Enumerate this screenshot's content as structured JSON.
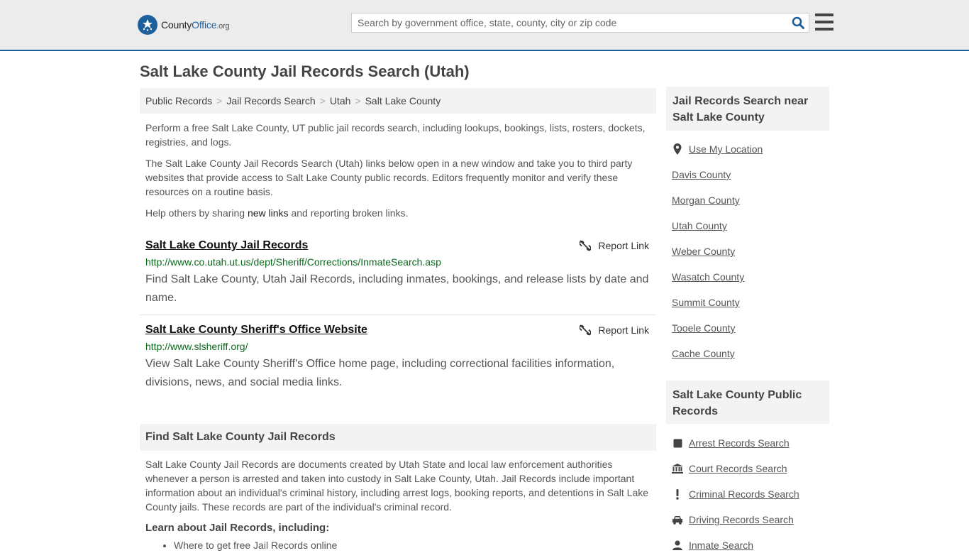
{
  "header": {
    "logo": {
      "word1": "County",
      "word2": "Office",
      "tld": ".org"
    },
    "search": {
      "placeholder": "Search by government office, state, county, city or zip code",
      "value": ""
    }
  },
  "page_title": "Salt Lake County Jail Records Search (Utah)",
  "breadcrumb": [
    "Public Records",
    "Jail Records Search",
    "Utah",
    "Salt Lake County"
  ],
  "breadcrumb_separator": ">",
  "intro": {
    "p1": "Perform a free Salt Lake County, UT public jail records search, including lookups, bookings, lists, rosters, dockets, registries, and logs.",
    "p2": "The Salt Lake County Jail Records Search (Utah) links below open in a new window and take you to third party websites that provide access to Salt Lake County public records. Editors frequently monitor and verify these resources on a routine basis.",
    "p3_before": "Help others by sharing ",
    "p3_link": "new links",
    "p3_after": " and reporting broken links."
  },
  "results": [
    {
      "title": "Salt Lake County Jail Records",
      "report_label": "Report Link",
      "url": "http://www.co.utah.ut.us/dept/Sheriff/Corrections/InmateSearch.asp",
      "description": "Find Salt Lake County, Utah Jail Records, including inmates, bookings, and release lists by date and name."
    },
    {
      "title": "Salt Lake County Sheriff's Office Website",
      "report_label": "Report Link",
      "url": "http://www.slsheriff.org/",
      "description": "View Salt Lake County Sheriff's Office home page, including correctional facilities information, divisions, news, and social media links."
    }
  ],
  "find_section": {
    "heading": "Find Salt Lake County Jail Records",
    "body": "Salt Lake County Jail Records are documents created by Utah State and local law enforcement authorities whenever a person is arrested and taken into custody in Salt Lake County, Utah. Jail Records include important information about an individual's criminal history, including arrest logs, booking reports, and detentions in Salt Lake County jails. These records are part of the individual's criminal record.",
    "learn_heading": "Learn about Jail Records, including:",
    "learn_items": [
      "Where to get free Jail Records online"
    ]
  },
  "sidebar_nearby": {
    "heading": "Jail Records Search near Salt Lake County",
    "use_location": "Use My Location",
    "counties": [
      "Davis County",
      "Morgan County",
      "Utah County",
      "Weber County",
      "Wasatch County",
      "Summit County",
      "Tooele County",
      "Cache County"
    ]
  },
  "sidebar_public": {
    "heading": "Salt Lake County Public Records",
    "items": [
      {
        "label": "Arrest Records Search",
        "icon": "square-icon"
      },
      {
        "label": "Court Records Search",
        "icon": "courthouse-icon"
      },
      {
        "label": "Criminal Records Search",
        "icon": "exclamation-icon"
      },
      {
        "label": "Driving Records Search",
        "icon": "car-icon"
      },
      {
        "label": "Inmate Search",
        "icon": "inmate-icon"
      }
    ]
  },
  "colors": {
    "brand": "#1c5f9b",
    "url_green": "#0a6a1c",
    "panel": "#f3f3f3",
    "topbar": "#ececec"
  }
}
